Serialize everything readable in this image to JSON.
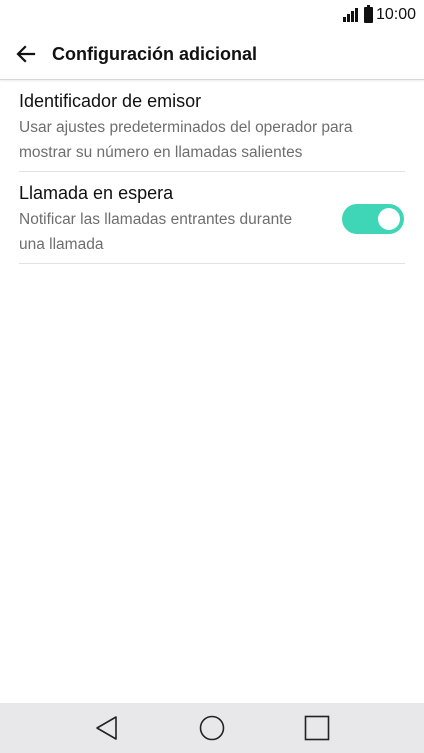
{
  "status_bar": {
    "time": "10:00"
  },
  "header": {
    "title": "Configuración adicional"
  },
  "settings": [
    {
      "title": "Identificador de emisor",
      "description_lines": [
        "Usar ajustes predeterminados del operador para",
        "mostrar su número en llamadas salientes"
      ]
    },
    {
      "title": "Llamada en espera",
      "description_lines": [
        "Notificar las llamadas entrantes durante",
        "una llamada"
      ],
      "toggle_on": true
    }
  ],
  "colors": {
    "toggle_on": "#3fd6b7",
    "nav_bar": "#e8e8ea"
  },
  "icons": {
    "back": "arrow-left-icon",
    "signal": "signal-icon",
    "battery": "battery-icon",
    "nav_back": "triangle-back-icon",
    "nav_home": "circle-home-icon",
    "nav_recents": "square-recents-icon"
  }
}
